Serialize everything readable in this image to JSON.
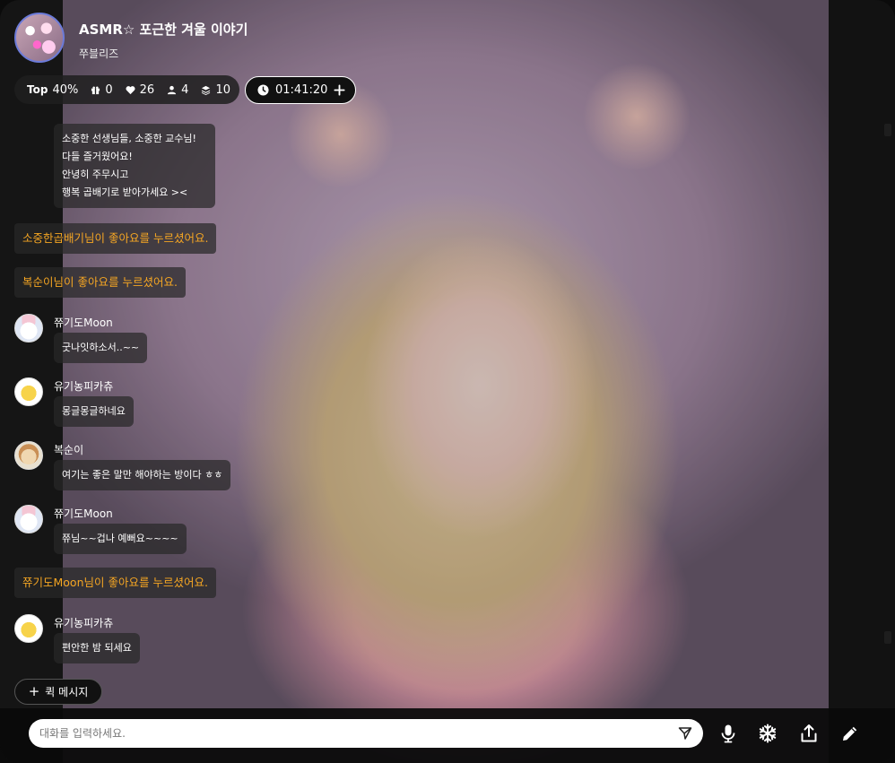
{
  "header": {
    "title": "ASMR☆ 포근한 겨울 이야기",
    "host": "쭈블리즈"
  },
  "stats": {
    "top_label": "Top",
    "top_value": "40%",
    "gifts": "0",
    "likes": "26",
    "viewers": "4",
    "layers": "10",
    "timer": "01:41:20"
  },
  "chat": {
    "pinned_lines": [
      "소중한 선생님들, 소중한 교수님!",
      "다들 즐거웠어요!",
      "안녕히 주무시고",
      "행복 곱배기로 받아가세요 ><"
    ],
    "system_1": "소중한곱배기님이 좋아요를 누르셨어요.",
    "system_2": "복순이님이 좋아요를 누르셨어요.",
    "messages": [
      {
        "nick": "쮸기도Moon",
        "text": "굿나잇하소서..~~"
      },
      {
        "nick": "유기농피카츄",
        "text": "몽글몽글하네요"
      },
      {
        "nick": "복순이",
        "text": "여기는 좋은 말만 해야하는 방이다 ㅎㅎ"
      },
      {
        "nick": "쮸기도Moon",
        "text": "쮸님~~겁나 예뻐요~~~~"
      }
    ],
    "system_3": "쮸기도Moon님이 좋아요를 누르셨어요.",
    "last_message": {
      "nick": "유기농피카츄",
      "text": "편안한 밤 되세요"
    }
  },
  "quick_message_label": "퀵 메시지",
  "input": {
    "placeholder": "대화를 입력하세요."
  },
  "icons": {
    "send": "send-icon",
    "mic": "mic-icon",
    "snowflake": "snowflake-icon",
    "share": "share-icon",
    "pencil": "pencil-icon"
  },
  "colors": {
    "system_text": "#f5a623",
    "avatar_ring": "#6c7bd9"
  }
}
